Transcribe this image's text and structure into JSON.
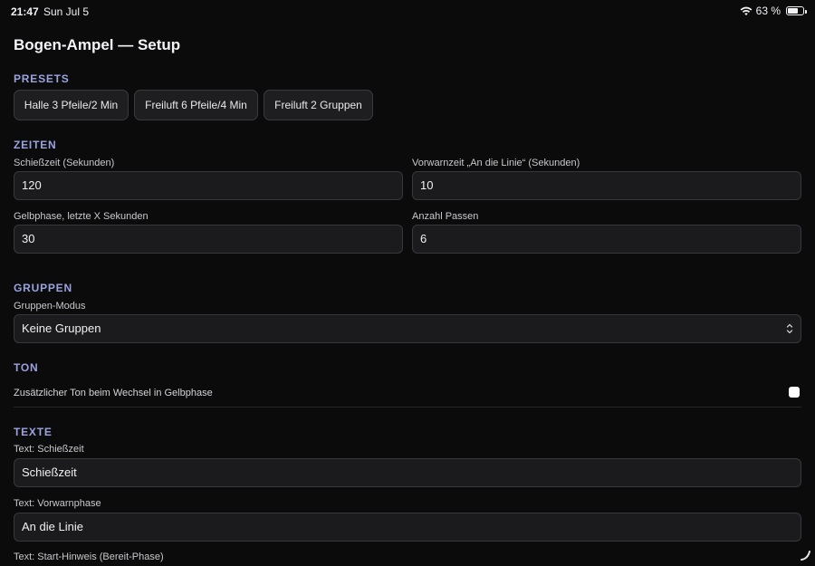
{
  "status_bar": {
    "time": "21:47",
    "date": "Sun Jul 5",
    "battery_text": "63 %",
    "battery_level": 0.63,
    "icons": [
      "wifi-icon",
      "battery-icon"
    ]
  },
  "page": {
    "title": "Bogen-Ampel — Setup"
  },
  "presets": {
    "section_title": "PRESETS",
    "buttons": [
      {
        "label": "Halle 3 Pfeile/2 Min"
      },
      {
        "label": "Freiluft 6 Pfeile/4 Min"
      },
      {
        "label": "Freiluft 2 Gruppen"
      }
    ]
  },
  "zeiten": {
    "section_title": "ZEITEN",
    "fields": [
      {
        "label": "Schießzeit (Sekunden)",
        "value": "120"
      },
      {
        "label": "Vorwarnzeit „An die Linie“ (Sekunden)",
        "value": "10"
      },
      {
        "label": "Gelbphase, letzte X Sekunden",
        "value": "30"
      },
      {
        "label": "Anzahl Passen",
        "value": "6"
      }
    ]
  },
  "gruppen": {
    "section_title": "GRUPPEN",
    "mode_label": "Gruppen-Modus",
    "mode_selected": "Keine Gruppen"
  },
  "ton": {
    "section_title": "TON",
    "toggle_label": "Zusätzlicher Ton beim Wechsel in Gelbphase",
    "toggle_checked": false
  },
  "texte": {
    "section_title": "TEXTE",
    "fields": [
      {
        "label": "Text: Schießzeit",
        "value": "Schießzeit"
      },
      {
        "label": "Text: Vorwarnphase",
        "value": "An die Linie"
      },
      {
        "label": "Text: Start-Hinweis (Bereit-Phase)"
      }
    ]
  },
  "colors": {
    "background": "#0b0b0c",
    "section_title": "#9aa3de",
    "input_bg": "#1b1b1d",
    "input_border": "#38383c"
  }
}
